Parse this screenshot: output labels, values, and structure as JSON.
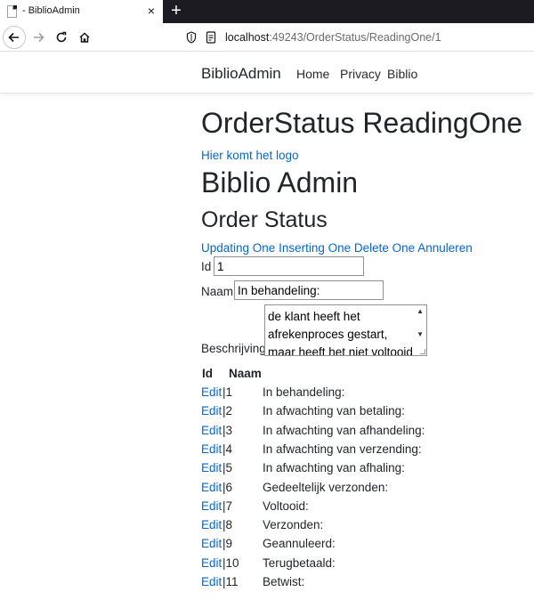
{
  "browser": {
    "tab_title": "- BiblioAdmin",
    "tab_close": "×",
    "new_tab": "+",
    "url_host": "localhost",
    "url_path": ":49243/OrderStatus/ReadingOne/1"
  },
  "header": {
    "brand": "BiblioAdmin",
    "nav": [
      "Home",
      "Privacy",
      "Biblio"
    ]
  },
  "page": {
    "title": "OrderStatus ReadingOne",
    "logo_link": "Hier komt het logo",
    "heading": "Biblio Admin",
    "subheading": "Order Status",
    "actions": [
      "Updating One",
      "Inserting One",
      "Delete One",
      "Annuleren"
    ]
  },
  "form": {
    "id_label": "Id",
    "id_value": "1",
    "naam_label": "Naam",
    "naam_value": "In behandeling:",
    "beschrijving_label": "Beschrijving",
    "beschrijving_value": "de klant heeft het afrekenproces gestart, maar heeft het niet voltooid"
  },
  "table": {
    "headers": [
      "Id",
      "Naam"
    ],
    "edit_label": "Edit",
    "rows": [
      {
        "id": "|1",
        "naam": "In behandeling:"
      },
      {
        "id": "|2",
        "naam": "In afwachting van betaling:"
      },
      {
        "id": "|3",
        "naam": "In afwachting van afhandeling:"
      },
      {
        "id": "|4",
        "naam": "In afwachting van verzending:"
      },
      {
        "id": "|5",
        "naam": "In afwachting van afhaling:"
      },
      {
        "id": "|6",
        "naam": "Gedeeltelijk verzonden:"
      },
      {
        "id": "|7",
        "naam": "Voltooid:"
      },
      {
        "id": "|8",
        "naam": "Verzonden:"
      },
      {
        "id": "|9",
        "naam": "Geannuleerd:"
      },
      {
        "id": "|10",
        "naam": "Terugbetaald:"
      },
      {
        "id": "|11",
        "naam": "Betwist:"
      }
    ]
  },
  "colors": {
    "link": "#0366d6",
    "tabbar": "#1c1b22",
    "text": "#212529"
  }
}
